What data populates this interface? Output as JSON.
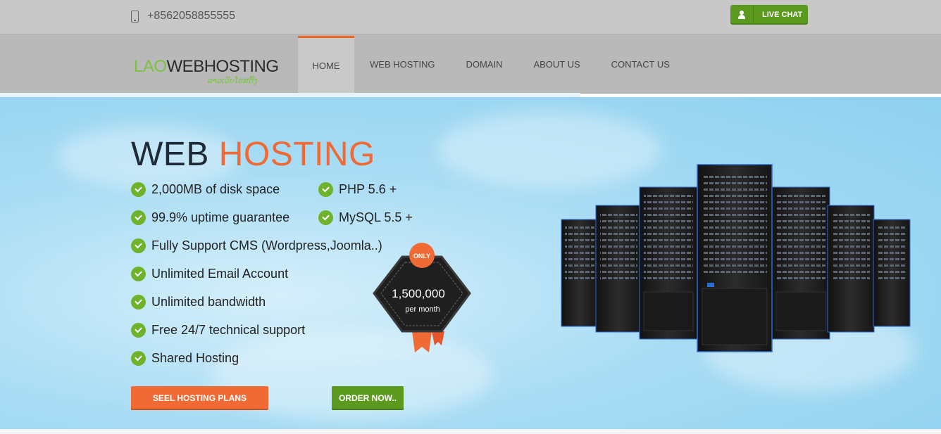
{
  "topbar": {
    "phone": "+8562058855555",
    "live_chat_label": "LIVE CHAT"
  },
  "brand": {
    "logo_part1": "LAO",
    "logo_part2": "WEBHOSTING",
    "logo_sub": "ລາວເວັບໂຮສຕິ້ງ"
  },
  "nav": {
    "items": [
      "HOME",
      "WEB HOSTING",
      "DOMAIN",
      "ABOUT US",
      "CONTACT US"
    ],
    "active": "HOME"
  },
  "hero": {
    "title_part1": "WEB",
    "title_part2": "HOSTING",
    "features_left": [
      "2,000MB of disk space",
      "99.9% uptime guarantee",
      "Fully Support CMS (Wordpress,Joomla..)",
      "Unlimited Email Account",
      "Unlimited bandwidth",
      "Free 24/7 technical support",
      "Shared Hosting"
    ],
    "features_right": [
      "PHP 5.6 +",
      "MySQL 5.5 +"
    ],
    "badge": {
      "ribbon": "ONLY",
      "price": "1,500,000",
      "period": "per month"
    },
    "btn_plans": "SEEL HOSTING PLANS",
    "btn_order": "ORDER NOW.."
  },
  "colors": {
    "accent_orange": "#f06a35",
    "accent_green": "#5c9a1f",
    "check_green": "#6fb22c",
    "hero_sky": "#a8dcf4"
  }
}
